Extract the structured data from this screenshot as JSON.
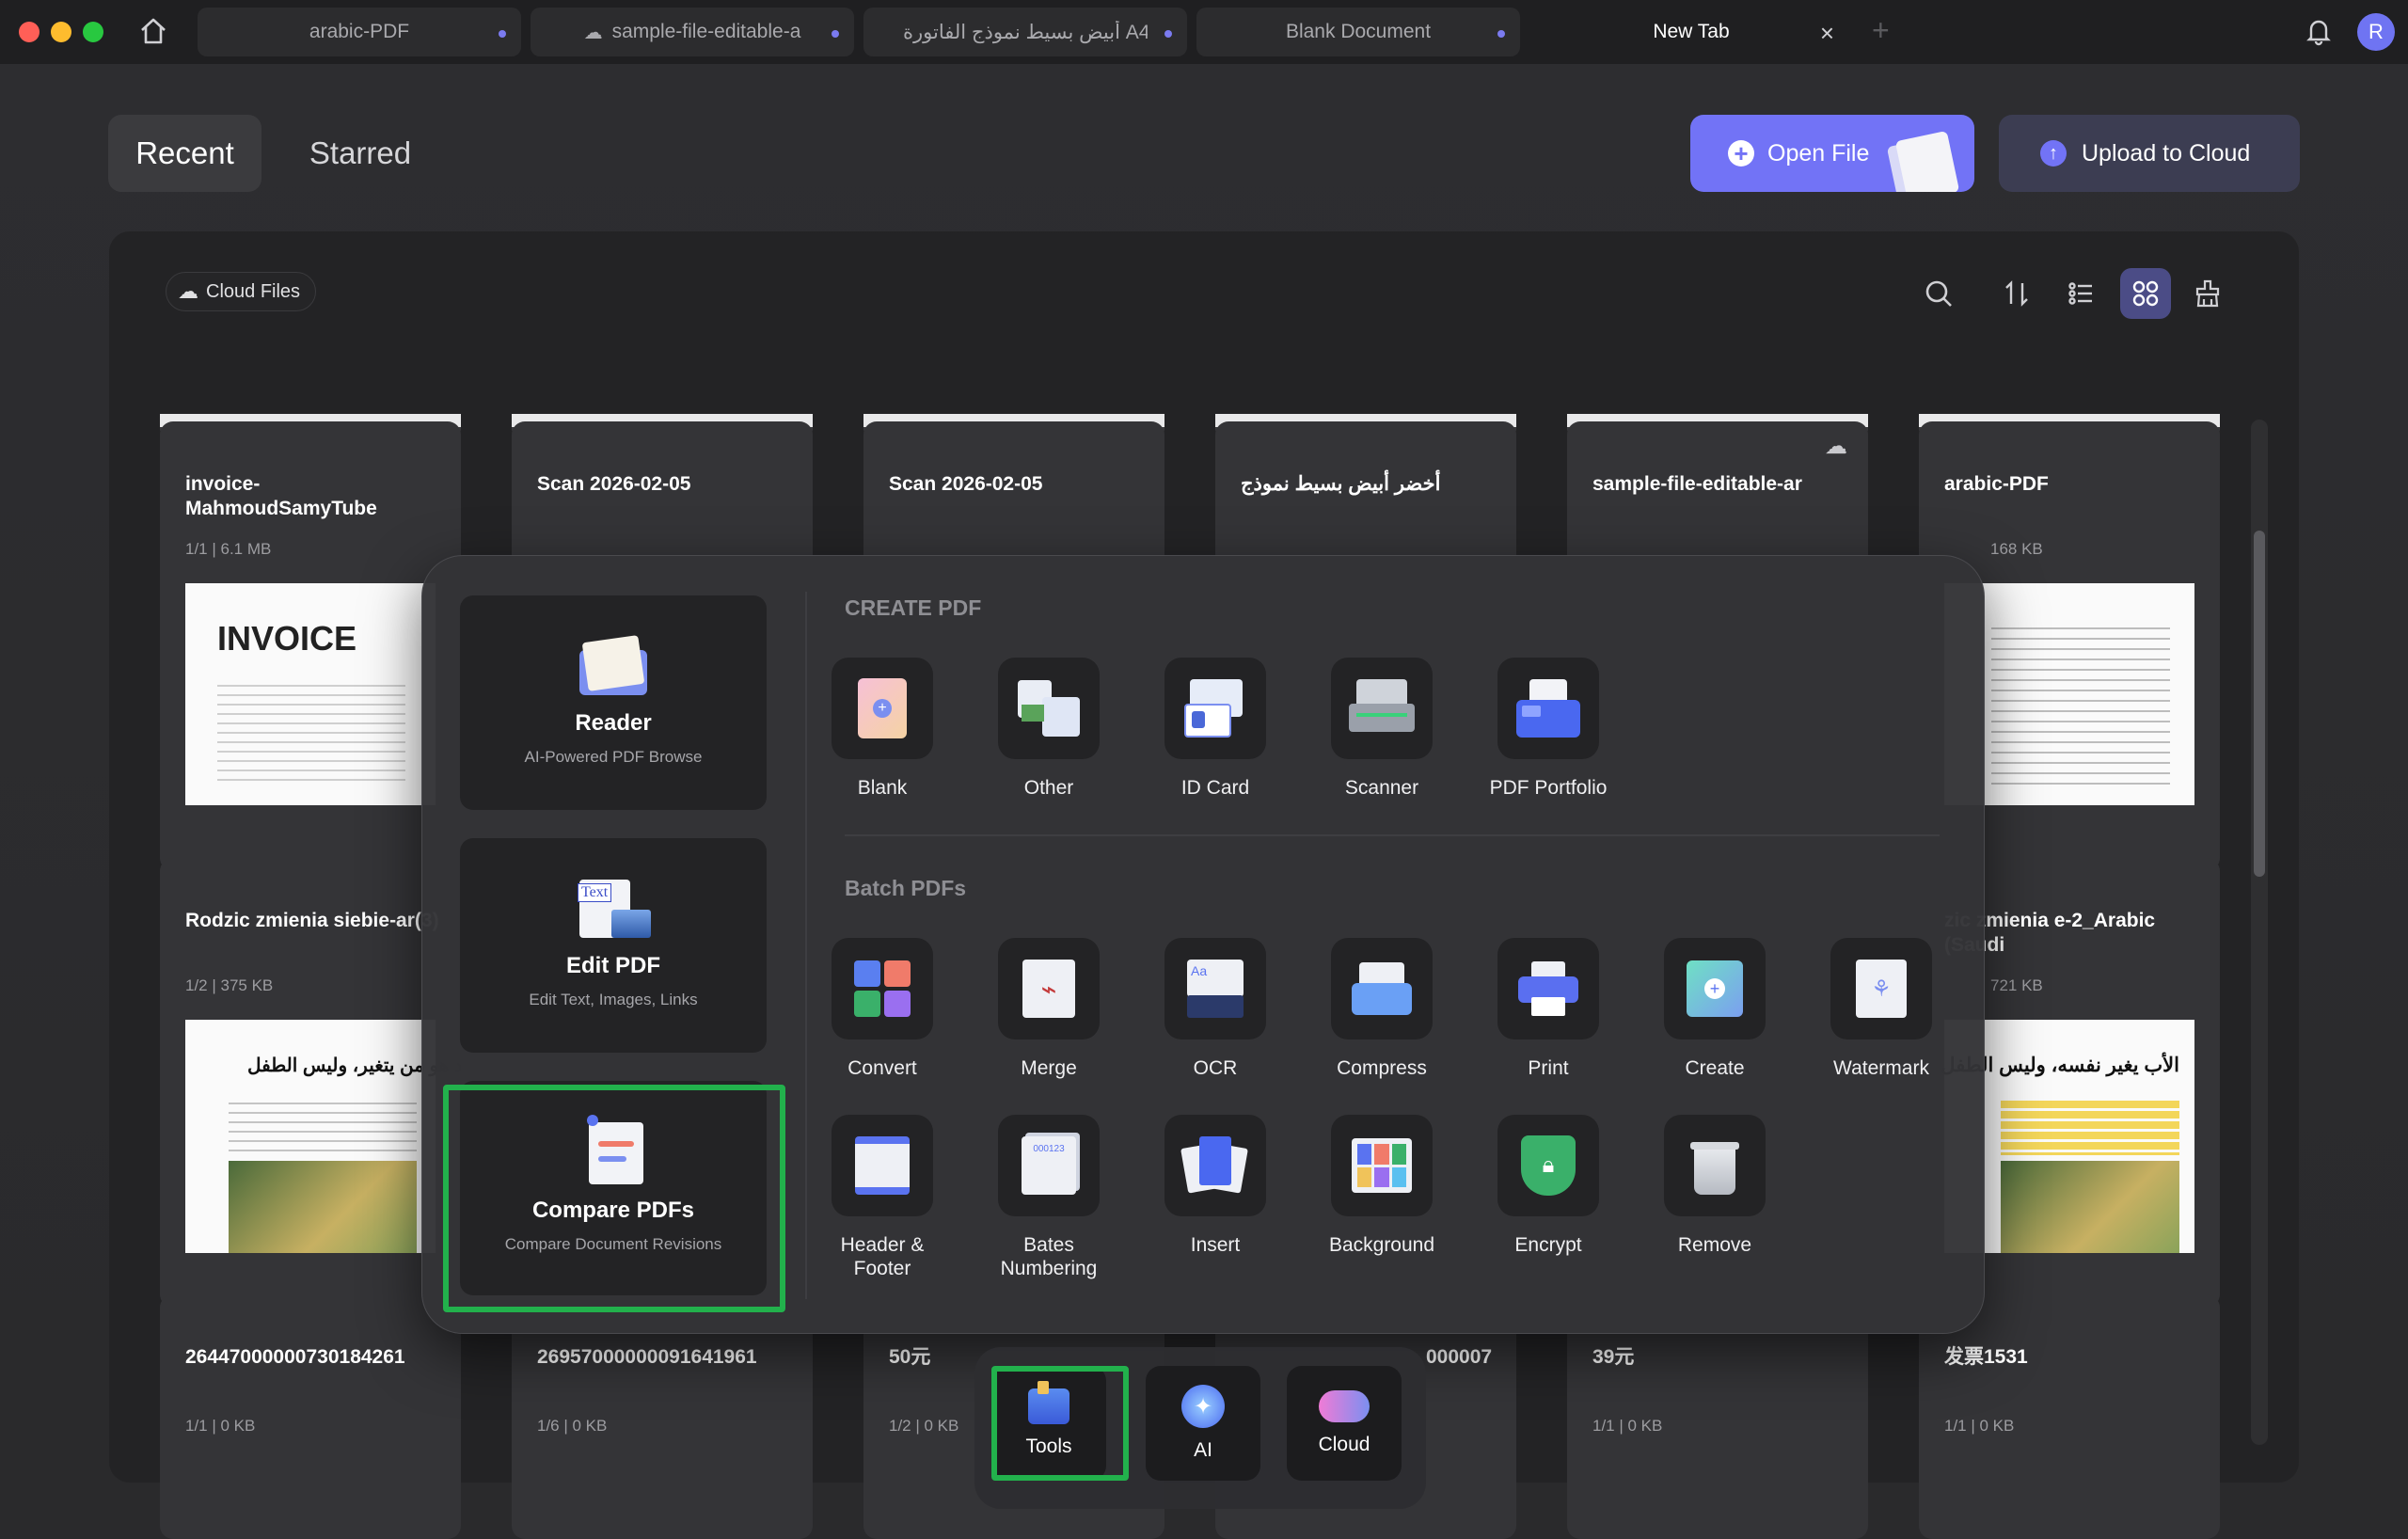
{
  "tabs": [
    {
      "label": "arabic-PDF"
    },
    {
      "label": "sample-file-editable-a"
    },
    {
      "label": "أبيض بسيط نموذج الفاتورة A4"
    },
    {
      "label": "Blank Document"
    },
    {
      "label": "New Tab"
    }
  ],
  "avatar": "R",
  "header": {
    "recent": "Recent",
    "starred": "Starred",
    "open_file": "Open File",
    "upload_cloud": "Upload to Cloud"
  },
  "files": {
    "filter_chip": "Cloud Files",
    "row1": [
      {
        "name": "invoice-MahmoudSamyTube",
        "meta": "1/1 | 6.1 MB",
        "thumb_title": "INVOICE"
      },
      {
        "name": "Scan 2026-02-05",
        "meta": ""
      },
      {
        "name": "Scan 2026-02-05",
        "meta": ""
      },
      {
        "name": "أخضر أبيض بسيط نموذج",
        "meta": ""
      },
      {
        "name": "sample-file-editable-ar",
        "meta": ""
      },
      {
        "name": "arabic-PDF",
        "meta": "168 KB"
      }
    ],
    "row2": [
      {
        "name": "Rodzic zmienia siebie-ar(3)",
        "meta": "1/2 | 375 KB",
        "thumb_text": "الد هو من يتغير، وليس الطفل"
      },
      {
        "name": "zic zmienia e-2_Arabic (Saudi",
        "meta": "721 KB",
        "thumb_text": "الأب يغير نفسه، وليس الطفل"
      }
    ],
    "row3": [
      {
        "name": "26447000000730184261",
        "meta": "1/1 | 0 KB"
      },
      {
        "name": "26957000000091641961",
        "meta": "1/6 | 0 KB"
      },
      {
        "name": "50元",
        "meta": "1/2 | 0 KB"
      },
      {
        "name": "000007",
        "meta": ""
      },
      {
        "name": "39元",
        "meta": "1/1 | 0 KB"
      },
      {
        "name": "发票1531",
        "meta": "1/1 | 0 KB"
      }
    ]
  },
  "tools_popup": {
    "features": [
      {
        "title": "Reader",
        "subtitle": "AI-Powered PDF Browse"
      },
      {
        "title": "Edit PDF",
        "subtitle": "Edit Text, Images, Links"
      },
      {
        "title": "Compare PDFs",
        "subtitle": "Compare Document Revisions"
      }
    ],
    "create_title": "CREATE PDF",
    "create_items": [
      "Blank",
      "Other",
      "ID Card",
      "Scanner",
      "PDF Portfolio"
    ],
    "batch_title": "Batch PDFs",
    "batch_row1": [
      "Convert",
      "Merge",
      "OCR",
      "Compress",
      "Print",
      "Create",
      "Watermark"
    ],
    "batch_row2": [
      "Header & Footer",
      "Bates Numbering",
      "Insert",
      "Background",
      "Encrypt",
      "Remove"
    ]
  },
  "dock": {
    "tools": "Tools",
    "ai": "AI",
    "cloud": "Cloud"
  },
  "colors": {
    "accent": "#7273f6",
    "highlight": "#22b14c"
  }
}
